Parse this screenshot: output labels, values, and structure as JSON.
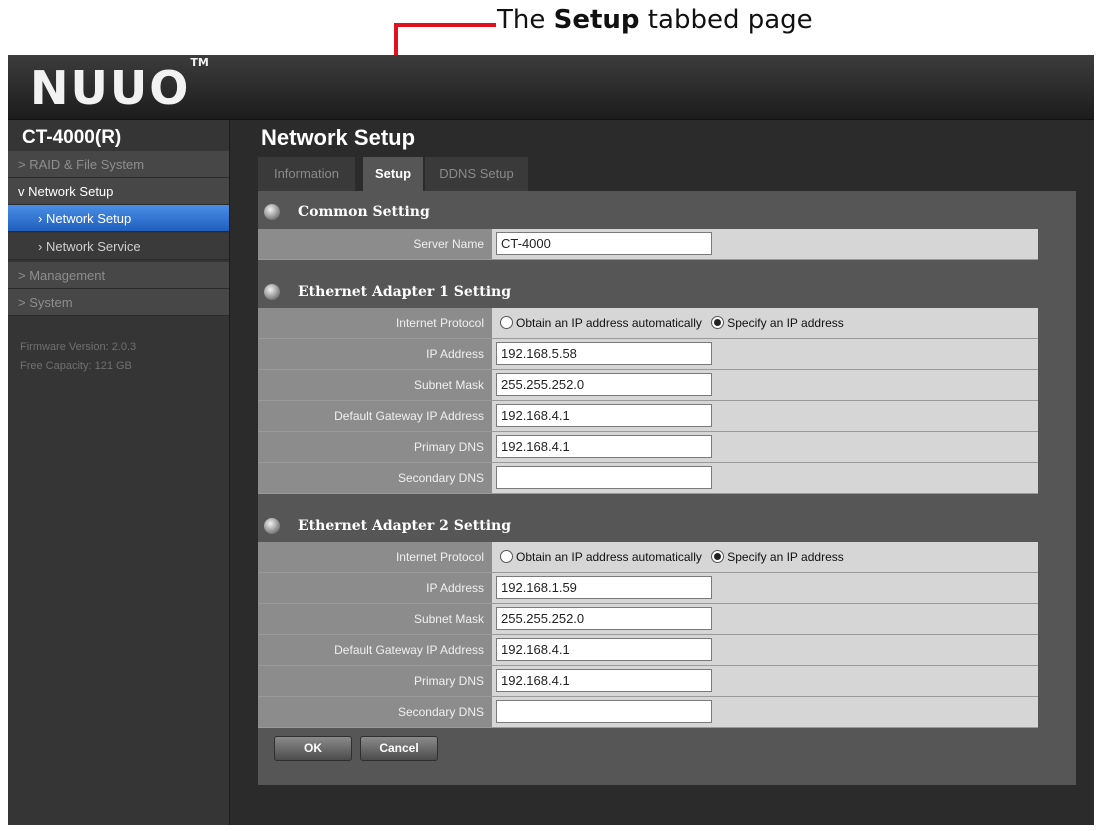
{
  "annotation": {
    "pre": "The ",
    "bold": "Setup",
    "post": " tabbed page",
    "arrow_color": "#e0101e"
  },
  "header": {
    "logo": "NUUO",
    "trademark": "TM"
  },
  "sidebar": {
    "device": "CT-4000(R)",
    "items": [
      {
        "label": "RAID & File System",
        "arrow": ">"
      },
      {
        "label": "Network Setup",
        "arrow": "v"
      },
      {
        "label": "Network Setup",
        "arrow": "›",
        "active": true
      },
      {
        "label": "Network Service",
        "arrow": "›"
      },
      {
        "label": "Management",
        "arrow": ">"
      },
      {
        "label": "System",
        "arrow": ">"
      }
    ],
    "firmware": "Firmware Version: 2.0.3",
    "capacity": "Free Capacity: 121 GB"
  },
  "main": {
    "title": "Network Setup",
    "tabs": [
      "Information",
      "Setup",
      "DDNS Setup"
    ],
    "active_tab": "Setup",
    "sections": [
      {
        "title": "Common Setting"
      },
      {
        "title": "Ethernet Adapter 1 Setting"
      },
      {
        "title": "Ethernet Adapter 2 Setting"
      }
    ],
    "common": {
      "server_name_label": "Server Name",
      "server_name": "CT-4000"
    },
    "eth1": {
      "protocol_label": "Internet Protocol",
      "opt_auto": "Obtain an IP address automatically",
      "opt_manual": "Specify an IP address",
      "selected": "manual",
      "ip_label": "IP Address",
      "ip": "192.168.5.58",
      "mask_label": "Subnet Mask",
      "mask": "255.255.252.0",
      "gw_label": "Default Gateway IP Address",
      "gw": "192.168.4.1",
      "dns1_label": "Primary DNS",
      "dns1": "192.168.4.1",
      "dns2_label": "Secondary DNS",
      "dns2": ""
    },
    "eth2": {
      "protocol_label": "Internet Protocol",
      "opt_auto": "Obtain an IP address automatically",
      "opt_manual": "Specify an IP address",
      "selected": "manual",
      "ip_label": "IP Address",
      "ip": "192.168.1.59",
      "mask_label": "Subnet Mask",
      "mask": "255.255.252.0",
      "gw_label": "Default Gateway IP Address",
      "gw": "192.168.4.1",
      "dns1_label": "Primary DNS",
      "dns1": "192.168.4.1",
      "dns2_label": "Secondary DNS",
      "dns2": ""
    },
    "buttons": {
      "ok": "OK",
      "cancel": "Cancel"
    }
  }
}
